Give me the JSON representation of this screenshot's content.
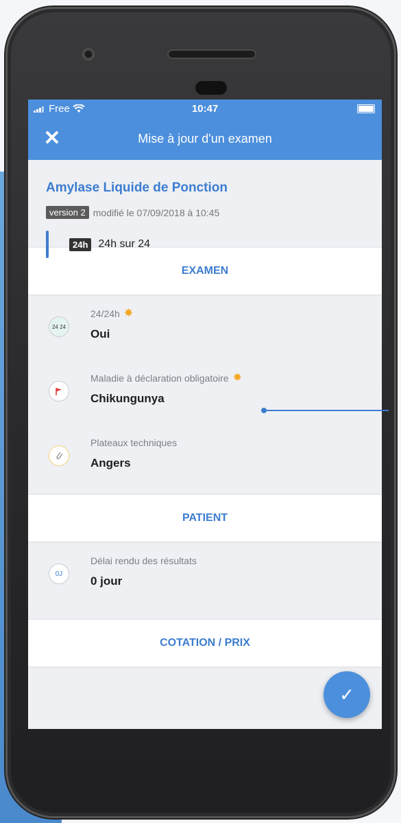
{
  "status_bar": {
    "carrier": "Free",
    "time": "10:47"
  },
  "nav": {
    "close_label": "✕",
    "title": "Mise à jour d'un examen"
  },
  "exam": {
    "name": "Amylase Liquide de Ponction",
    "version_tag": "version 2",
    "modified": "modifié le 07/09/2018 à 10:45",
    "availability_tag": "24h",
    "availability_label": "24h sur 24"
  },
  "sections": {
    "examen": "EXAMEN",
    "patient": "PATIENT",
    "cotation": "COTATION / PRIX"
  },
  "examen_items": [
    {
      "label": "24/24h",
      "value": "Oui",
      "icon": "24-24-icon",
      "icon_text": "24 24"
    },
    {
      "label": "Maladie à déclaration obligatoire",
      "value": "Chikungunya",
      "icon": "flag-icon"
    },
    {
      "label": "Plateaux techniques",
      "value": "Angers",
      "icon": "test-tube-icon"
    }
  ],
  "patient_items": [
    {
      "label": "Délai rendu des résultats",
      "value": "0 jour",
      "icon": "0j-icon",
      "icon_text": "0J"
    }
  ],
  "fab": {
    "icon": "check-icon",
    "glyph": "✓"
  },
  "colors": {
    "accent": "#4c8fdc",
    "title_blue": "#3d7dcf",
    "sun": "#f5a623",
    "flag": "#e0403a"
  }
}
